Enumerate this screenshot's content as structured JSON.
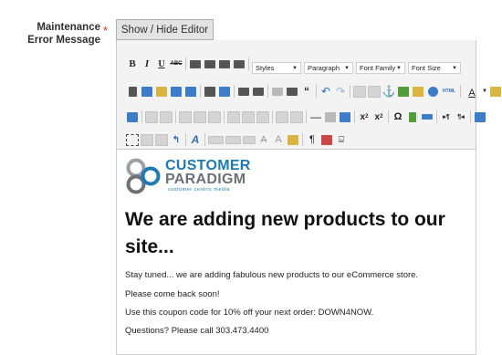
{
  "field": {
    "label": "Maintenance Error Message",
    "required_mark": "*"
  },
  "editor_toggle_label": "Show / Hide Editor",
  "toolbar": {
    "format_buttons": [
      "B",
      "I",
      "U",
      "ABC"
    ],
    "dropdowns": {
      "styles": "Styles",
      "paragraph": "Paragraph",
      "font_family": "Font Family",
      "font_size": "Font Size"
    },
    "html_button": "HTML"
  },
  "content": {
    "logo": {
      "line1": "CUSTOMER",
      "line2": "PARADIGM",
      "tagline": "customer centric media",
      "colors": {
        "blue": "#1d7ab5",
        "gray": "#6e7175"
      }
    },
    "heading": "We are adding new products to our site...",
    "paragraphs": [
      "Stay tuned... we are adding fabulous new products to our eCommerce store.",
      "Please come back soon!",
      "Use this coupon code for 10% off your next order: DOWN4NOW.",
      "Questions? Please call 303.473.4400"
    ]
  },
  "colors": {
    "required": "#e02b27",
    "button_bg": "#e3e3e3"
  }
}
